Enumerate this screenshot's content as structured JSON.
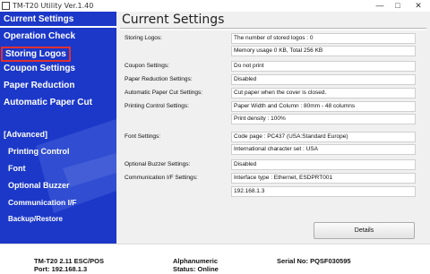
{
  "window": {
    "title": "TM-T20 Utility Ver.1.40",
    "minimize_label": "—",
    "maximize_label": "□",
    "close_label": "✕"
  },
  "sidebar": {
    "items": [
      {
        "label": "Current Settings"
      },
      {
        "label": "Operation Check"
      },
      {
        "label": "Storing Logos"
      },
      {
        "label": "Coupon Settings"
      },
      {
        "label": "Paper Reduction"
      },
      {
        "label": "Automatic Paper Cut"
      }
    ],
    "advanced_header": "[Advanced]",
    "advanced_items": [
      {
        "label": "Printing Control"
      },
      {
        "label": "Font"
      },
      {
        "label": "Optional Buzzer"
      },
      {
        "label": "Communication I/F"
      },
      {
        "label": "Backup/Restore"
      }
    ]
  },
  "main": {
    "title": "Current Settings",
    "settings": [
      {
        "label": "Storing Logos:",
        "values": [
          "The number of stored logos : 0",
          "Memory usage 0 KB, Total 256 KB"
        ]
      },
      {
        "label": "Coupon Settings:",
        "values": [
          "Do not print"
        ]
      },
      {
        "label": "Paper Reduction Settings:",
        "values": [
          "Disabled"
        ]
      },
      {
        "label": "Automatic Paper Cut Settings:",
        "values": [
          "Cut paper when the cover is closed."
        ]
      },
      {
        "label": "Printing Control Settings:",
        "values": [
          "Paper Width and Column : 80mm - 48 columns",
          "Print density : 100%"
        ]
      },
      {
        "label": "Font Settings:",
        "values": [
          "Code page : PC437 (USA:Standard Europe)",
          "International character set : USA"
        ]
      },
      {
        "label": "Optional Buzzer Settings:",
        "values": [
          "Disabled"
        ]
      },
      {
        "label": "Communication I/F Settings:",
        "values": [
          "Interface type : Ethernet, ESDPRT001",
          "192.168.1.3"
        ]
      }
    ],
    "details_button": "Details"
  },
  "status": {
    "model": "TM-T20 2.11 ESC/POS",
    "port": "Port: 192.168.1.3",
    "charset": "Alphanumeric",
    "status": "Status: Online",
    "serial": "Serial No: PQSF030595"
  },
  "colors": {
    "sidebar_bg": "#1c38c8",
    "selected_outline": "#e03030"
  }
}
